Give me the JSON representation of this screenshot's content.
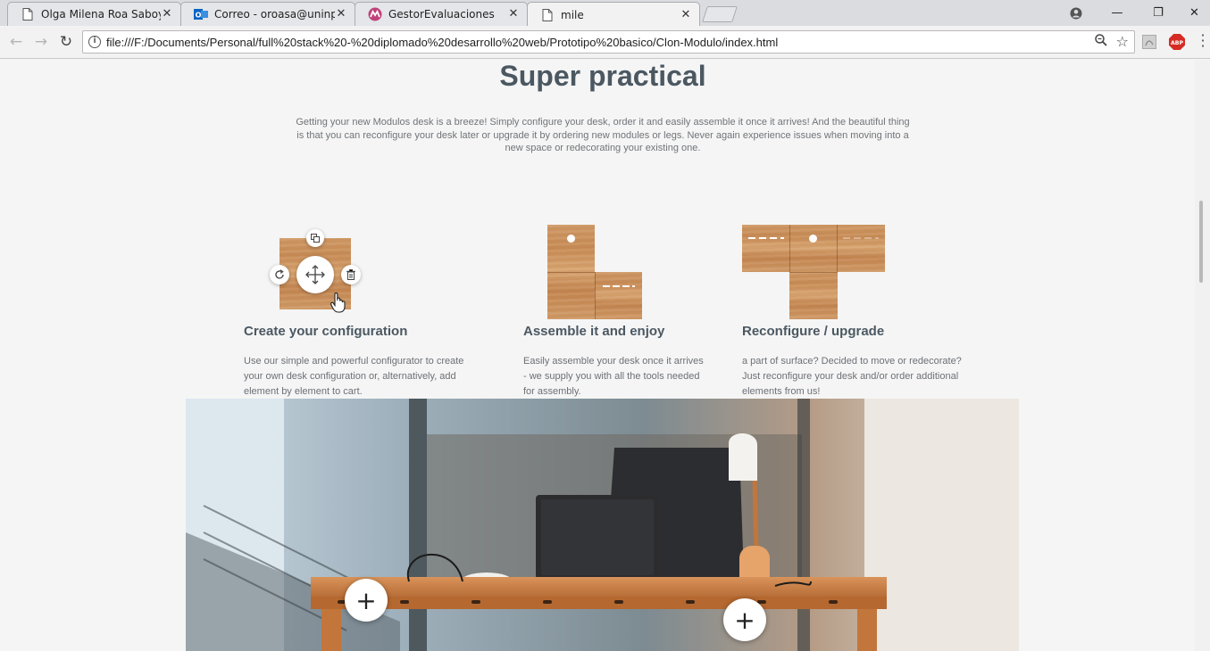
{
  "tabs": [
    {
      "title": "Olga Milena Roa Saboya",
      "icon": "document-icon",
      "active": false
    },
    {
      "title": "Correo - oroasa@uninpa",
      "icon": "outlook-icon",
      "active": false
    },
    {
      "title": "GestorEvaluaciones",
      "icon": "gestor-logo-icon",
      "active": false
    },
    {
      "title": "mile",
      "icon": "document-icon",
      "active": true
    }
  ],
  "tab_close": "✕",
  "window_controls": {
    "minimize": "—",
    "restore": "❐",
    "close": "✕"
  },
  "toolbar": {
    "back": "←",
    "forward": "→",
    "reload": "↻",
    "url": "file:///F:/Documents/Personal/full%20stack%20-%20diplomado%20desarrollo%20web/Prototipo%20basico/Clon-Modulo/index.html",
    "abp_label": "ABP"
  },
  "page": {
    "heading": "Super practical",
    "intro": "Getting your new Modulos desk is a breeze! Simply configure your desk, order it and easily assemble it once it arrives! And the beautiful thing is that you can reconfigure your desk later or upgrade it by ordering new modules or legs. Never again experience issues when moving into a new space or redecorating your existing one.",
    "features": [
      {
        "title": "Create your configuration",
        "text": "Use our simple and powerful configurator to create your own desk configuration or, alternatively, add element by element to cart."
      },
      {
        "title": "Assemble it and enjoy",
        "text": "Easily assemble your desk once it arrives - we supply you with all the tools needed for assembly."
      },
      {
        "title": "Reconfigure / upgrade",
        "text": "a part of surface? Decided to move or redecorate? Just reconfigure your desk and/or order additional elements from us!"
      }
    ],
    "plus_label": "+"
  },
  "colors": {
    "heading": "#4b5862",
    "body_text": "#6c7075",
    "background": "#f5f5f5"
  }
}
